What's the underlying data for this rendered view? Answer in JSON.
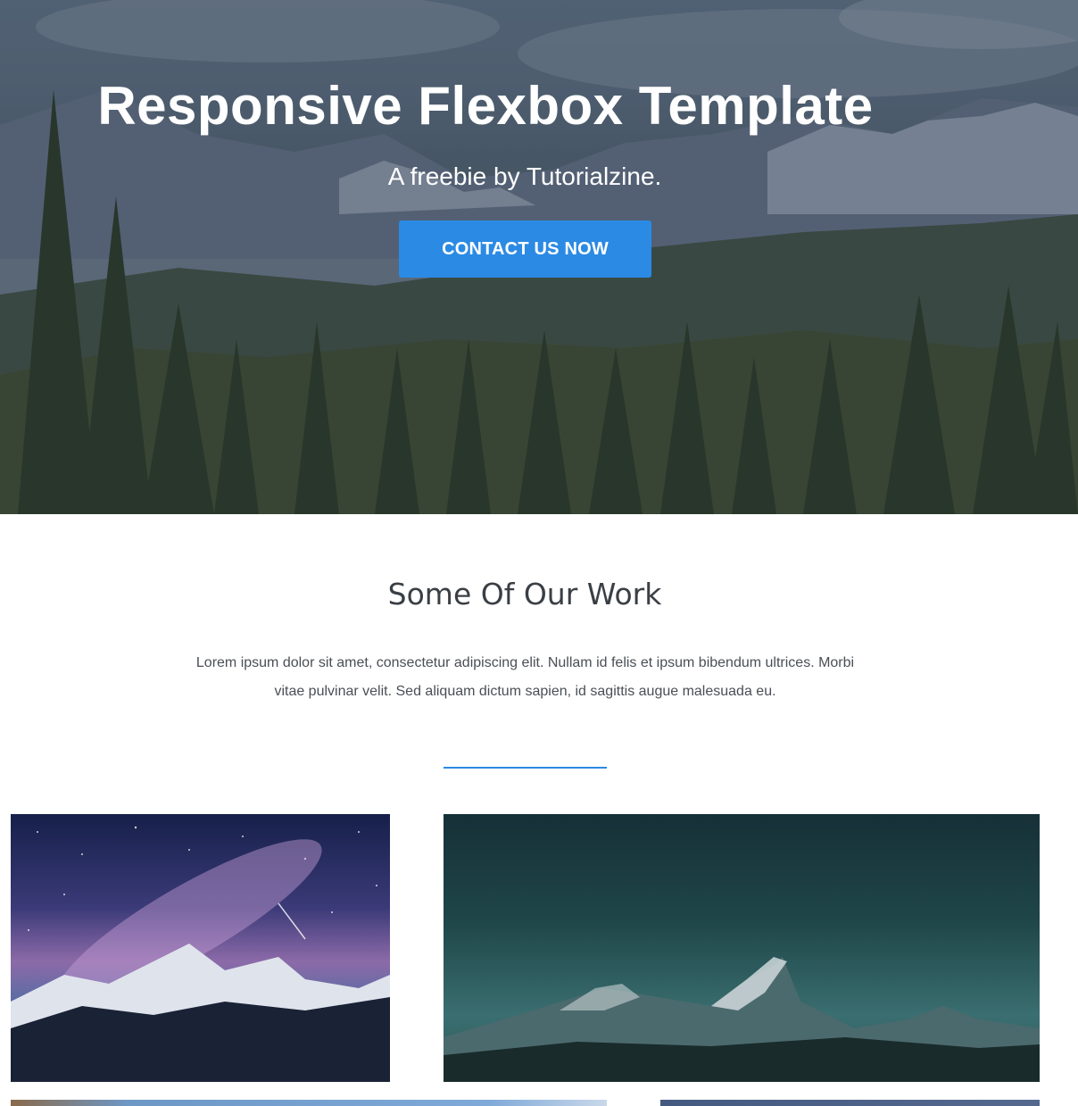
{
  "hero": {
    "title": "Responsive Flexbox Template",
    "subtitle": "A freebie by Tutorialzine.",
    "cta_label": "CONTACT US NOW"
  },
  "work": {
    "title": "Some Of Our Work",
    "text": "Lorem ipsum dolor sit amet, consectetur adipiscing elit. Nullam id felis et ipsum bibendum ultrices. Morbi vitae pulvinar velit. Sed aliquam dictum sapien, id sagittis augue malesuada eu."
  },
  "colors": {
    "accent": "#2b8ae4",
    "heading": "#3a3f45",
    "body_text": "#4a4f55"
  }
}
